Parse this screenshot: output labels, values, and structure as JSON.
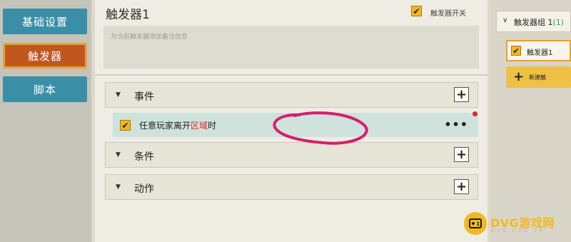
{
  "left_nav": {
    "items": [
      {
        "label": "基础设置"
      },
      {
        "label": "触发器"
      },
      {
        "label": "脚本"
      }
    ]
  },
  "header": {
    "title": "触发器1",
    "toggle_label": "触发器开关",
    "toggle_checked": true,
    "note_placeholder": "为当前触发器添加备注信息"
  },
  "sections": {
    "events": {
      "label": "事件"
    },
    "conditions": {
      "label": "条件"
    },
    "actions": {
      "label": "动作"
    }
  },
  "event_item": {
    "text_prefix": "任意玩家离开",
    "text_highlight": "区域",
    "text_suffix": "时",
    "more_label": "•••",
    "checked": true
  },
  "right_panel": {
    "group_label": "触发器组 1",
    "group_count": "(1)",
    "trigger_item_label": "触发器1",
    "new_trigger_label": "新建触"
  },
  "watermark": {
    "text": "DVG游戏网",
    "sub": "DVG.DVG.CN"
  },
  "colors": {
    "nav_blue": "#3a8ea6",
    "nav_active": "#c2561f",
    "checkbox": "#f2b71d",
    "highlight_red": "#e0282e",
    "annotation_pink": "#d61e6e"
  },
  "icons": {
    "section_caret": "caret-down-icon",
    "add": "plus-icon",
    "checkbox": "checkmark-icon",
    "group_chevron": "chevron-down-icon"
  }
}
